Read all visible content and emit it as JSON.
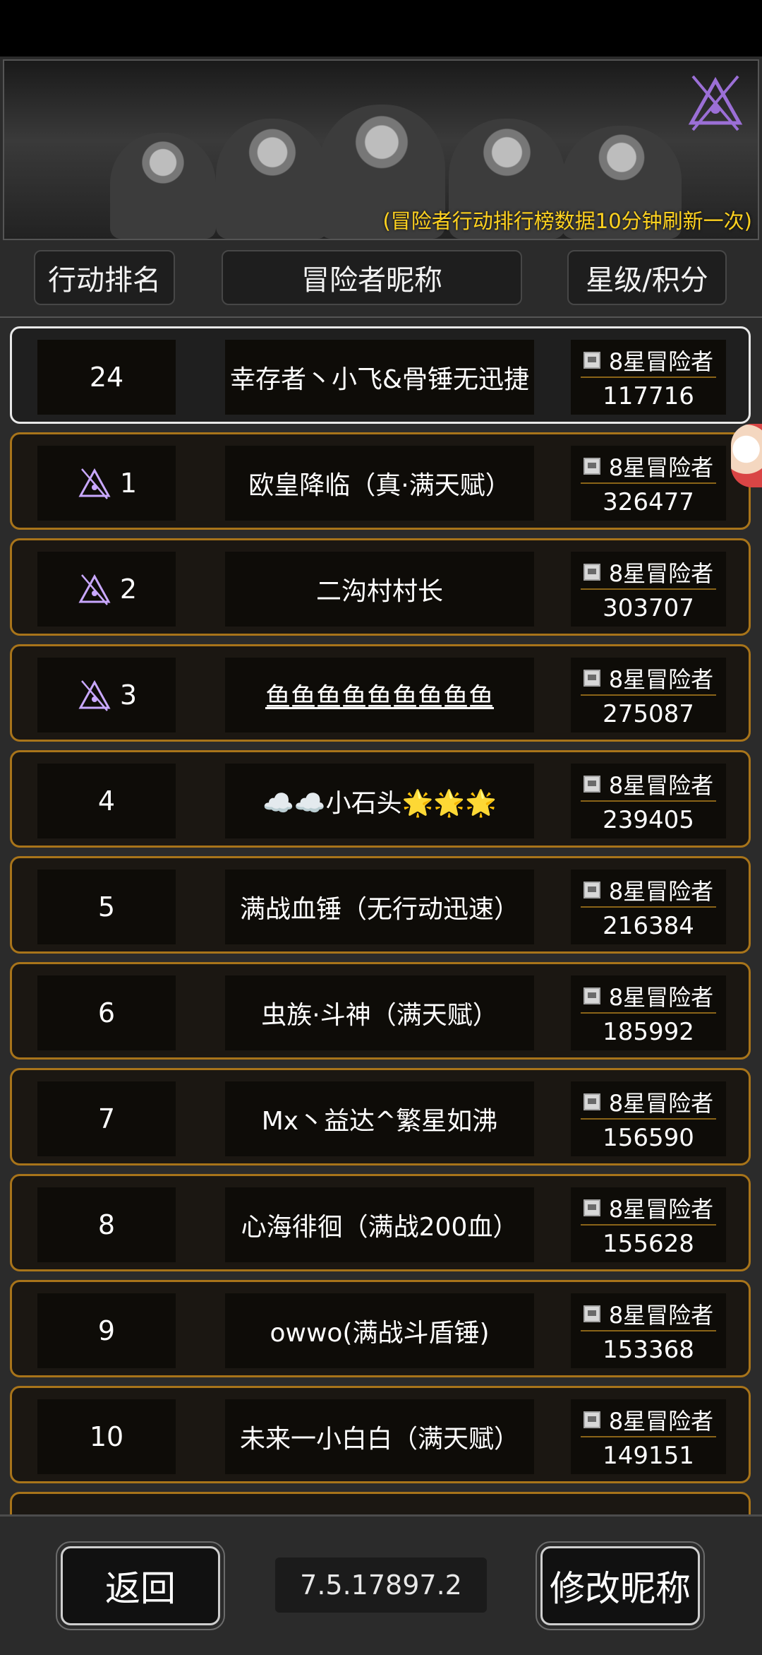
{
  "banner": {
    "note": "(冒险者行动排行榜数据10分钟刷新一次)"
  },
  "header": {
    "rank_label": "行动排名",
    "name_label": "冒险者昵称",
    "star_label": "星级/积分"
  },
  "my_row": {
    "rank": "24",
    "name": "幸存者丶小飞&骨锤无迅捷",
    "star": "8星冒险者",
    "score": "117716"
  },
  "rows": [
    {
      "rank": "1",
      "name": "欧皇降临（真·满天赋）",
      "star": "8星冒险者",
      "score": "326477"
    },
    {
      "rank": "2",
      "name": "二沟村村长",
      "star": "8星冒险者",
      "score": "303707"
    },
    {
      "rank": "3",
      "name": "鱼鱼鱼鱼鱼鱼鱼鱼鱼",
      "star": "8星冒险者",
      "score": "275087"
    },
    {
      "rank": "4",
      "name": "☁️☁️小石头🌟🌟🌟",
      "star": "8星冒险者",
      "score": "239405"
    },
    {
      "rank": "5",
      "name": "满战血锤（无行动迅速）",
      "star": "8星冒险者",
      "score": "216384"
    },
    {
      "rank": "6",
      "name": "虫族·斗神（满天赋）",
      "star": "8星冒险者",
      "score": "185992"
    },
    {
      "rank": "7",
      "name": "Mx丶益达^繁星如沸",
      "star": "8星冒险者",
      "score": "156590"
    },
    {
      "rank": "8",
      "name": "心海徘徊（满战200血）",
      "star": "8星冒险者",
      "score": "155628"
    },
    {
      "rank": "9",
      "name": "owwo(满战斗盾锤)",
      "star": "8星冒险者",
      "score": "153368"
    },
    {
      "rank": "10",
      "name": "未来一小白白（满天赋）",
      "star": "8星冒险者",
      "score": "149151"
    }
  ],
  "footer": {
    "back_label": "返回",
    "version": "7.5.17897.2",
    "rename_label": "修改昵称"
  },
  "colors": {
    "accent_gold": "#a8741a",
    "note_yellow": "#ffd21f",
    "emblem_purple": "#9b6fd6"
  },
  "icons": {
    "rank_top": "purple-triangle-emblem-icon",
    "level": "level-badge-icon",
    "gift": "gift-mascot-icon"
  }
}
